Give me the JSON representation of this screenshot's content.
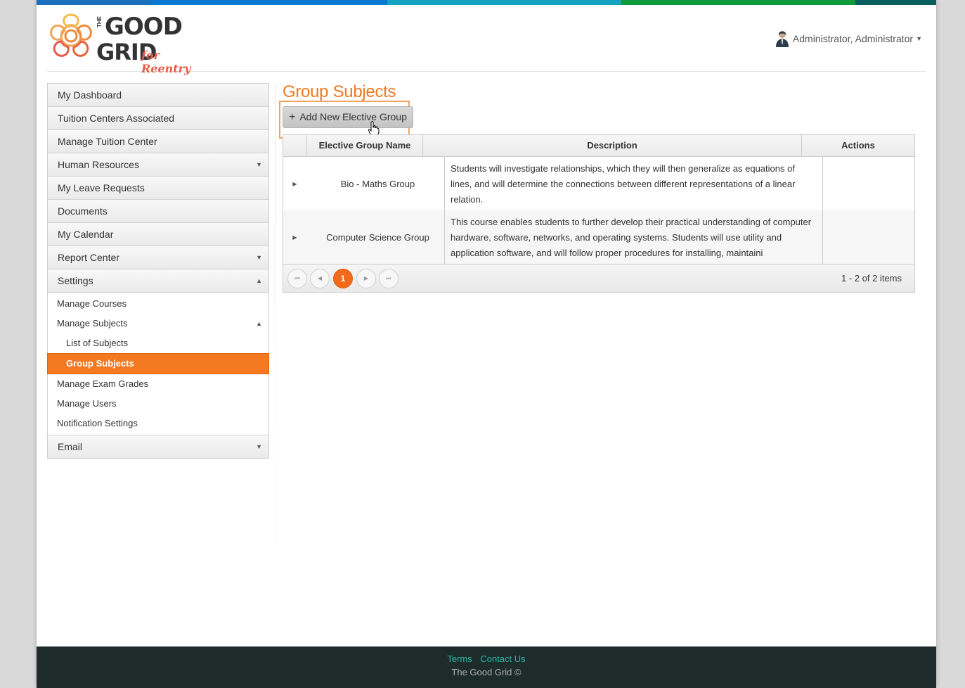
{
  "header": {
    "logo_the": "THE",
    "logo_good": "GOOD",
    "logo_grid": "GRID",
    "logo_reentry": "for Reentry",
    "user_name": "Administrator, Administrator",
    "topbar_colors": [
      "#1a6fbf",
      "#0a79d2",
      "#12a2c0",
      "#119a3c",
      "#075e5d"
    ]
  },
  "sidebar": {
    "items": [
      {
        "label": "My Dashboard"
      },
      {
        "label": "Tuition Centers Associated"
      },
      {
        "label": "Manage Tuition Center"
      },
      {
        "label": "Human Resources"
      },
      {
        "label": "My Leave Requests"
      },
      {
        "label": "Documents"
      },
      {
        "label": "My Calendar"
      },
      {
        "label": "Report Center"
      },
      {
        "label": "Settings"
      }
    ],
    "settings_sub": {
      "manage_courses": "Manage Courses",
      "manage_subjects": "Manage Subjects",
      "list_of_subjects": "List of Subjects",
      "group_subjects": "Group Subjects",
      "manage_exam_grades": "Manage Exam Grades",
      "manage_users": "Manage Users",
      "notification_settings": "Notification Settings"
    },
    "email": "Email"
  },
  "main": {
    "title": "Group Subjects",
    "add_button": "Add New Elective Group",
    "grid": {
      "headers": {
        "name": "Elective Group Name",
        "description": "Description",
        "actions": "Actions"
      },
      "rows": [
        {
          "name": "Bio - Maths Group",
          "description": "Students will investigate relationships, which they will then generalize as equations of lines, and will determine the connections between different representations of a linear relation."
        },
        {
          "name": "Computer Science Group",
          "description": "This course enables students to further develop their practical understanding of computer hardware, software, networks, and operating systems. Students will use utility and application software, and will follow proper procedures for installing, maintaini"
        }
      ],
      "pager": {
        "current_page": "1",
        "info": "1 - 2 of 2 items"
      }
    }
  },
  "footer": {
    "terms": "Terms",
    "contact": "Contact Us",
    "copyright": "The Good Grid ©"
  }
}
